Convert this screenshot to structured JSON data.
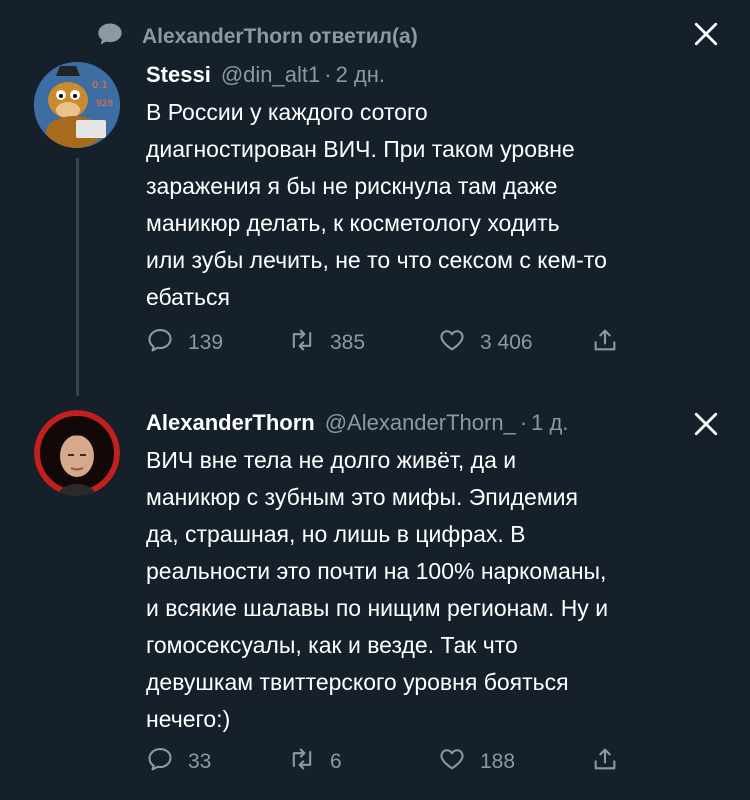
{
  "banner": {
    "text": "AlexanderThorn ответил(а)",
    "icon": "speech-bubble-icon"
  },
  "tweets": [
    {
      "display_name": "Stessi",
      "handle": "@din_alt1",
      "separator": "·",
      "time": "2 дн.",
      "text": "В России у каждого сотого\nдиагностирован ВИЧ. При таком уровне\nзаражения я бы не рискнула там даже\nманикюр делать, к косметологу ходить\nили зубы лечить, не то что сексом с кем-то\nебаться",
      "replies": "139",
      "retweets": "385",
      "likes": "3 406"
    },
    {
      "display_name": "AlexanderThorn",
      "handle": "@AlexanderThorn_",
      "separator": "·",
      "time": "1 д.",
      "text": "ВИЧ вне тела не долго живёт, да и\nманикюр с зубным это мифы. Эпидемия\nда, страшная, но лишь в цифрах. В\nреальности это почти на 100% наркоманы,\nи всякие шалавы по нищим регионам. Ну и\nгомосексуалы, как и везде. Так что\nдевушкам твиттерского уровня бояться\nнечего:)",
      "replies": "33",
      "retweets": "6",
      "likes": "188"
    }
  ],
  "colors": {
    "background": "#15202b",
    "muted": "#8b98a5",
    "text": "#ffffff",
    "thread_line": "#38444d"
  }
}
